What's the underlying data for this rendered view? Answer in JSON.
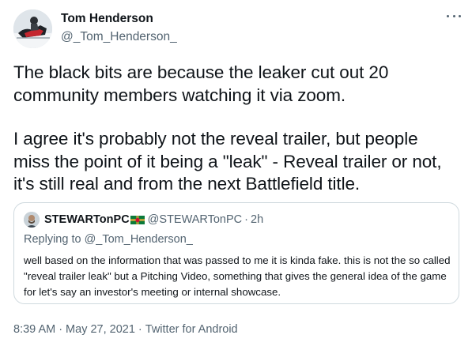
{
  "author": {
    "name": "Tom Henderson",
    "handle": "@_Tom_Henderson_",
    "avatar_icon": "snowmobile-rider-avatar"
  },
  "tweet": {
    "paragraph1": "The black bits are because the leaker cut out 20\ncommunity members watching it via zoom.",
    "paragraph2": "I agree it's probably not the reveal trailer, but people\nmiss the point of it being a \"leak\" - Reveal trailer or not,\nit's still real and from the next Battlefield title."
  },
  "quoted_tweet": {
    "name": "STEWARTonPC",
    "flag_icon": "dominica-flag-icon",
    "handle": "@STEWARTonPC",
    "separator": "·",
    "time": "2h",
    "replying_prefix": "Replying to ",
    "replying_to": "@_Tom_Henderson_",
    "text": "well based on the information that was passed to me it is kinda fake. this is not the so called \"reveal trailer leak\" but a Pitching Video, something that gives the general idea of the game for let's say an investor's meeting or internal showcase."
  },
  "meta": {
    "time": "8:39 AM",
    "separator": "·",
    "date": "May 27, 2021",
    "source": "Twitter for Android"
  },
  "colors": {
    "text_primary": "#0f1419",
    "text_secondary": "#536471",
    "border": "#cfd9de"
  }
}
